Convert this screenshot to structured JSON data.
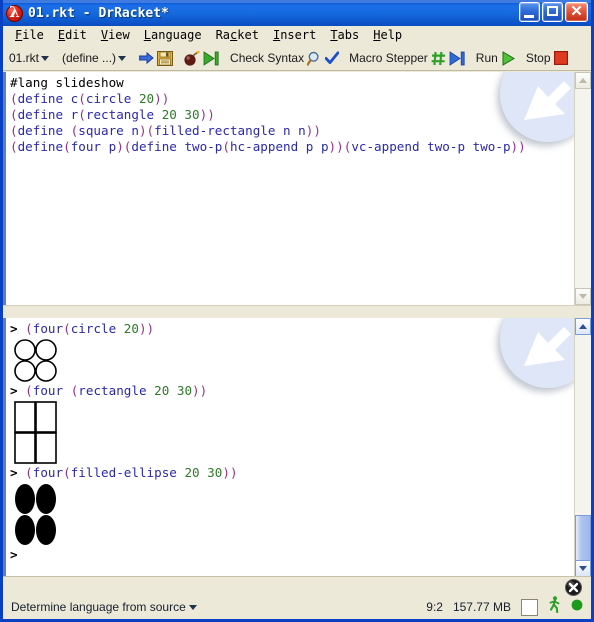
{
  "window": {
    "title": "01.rkt - DrRacket*",
    "app_icon": "racket-lambda-icon",
    "caption": {
      "minimize_label": "Minimize",
      "maximize_label": "Maximize",
      "close_label": "Close",
      "close_glyph": "✕"
    },
    "titlebar_color": "#1465DD",
    "frame_color": "#0A41C4",
    "chrome_color": "#ECE9D8"
  },
  "menubar": {
    "items": [
      {
        "pre": "",
        "mn": "F",
        "post": "ile"
      },
      {
        "pre": "",
        "mn": "E",
        "post": "dit"
      },
      {
        "pre": "",
        "mn": "V",
        "post": "iew"
      },
      {
        "pre": "",
        "mn": "L",
        "post": "anguage"
      },
      {
        "pre": "Ra",
        "mn": "c",
        "post": "ket"
      },
      {
        "pre": "",
        "mn": "I",
        "post": "nsert"
      },
      {
        "pre": "",
        "mn": "T",
        "post": "abs"
      },
      {
        "pre": "",
        "mn": "H",
        "post": "elp"
      }
    ]
  },
  "toolbar": {
    "file_dropdown": "01.rkt",
    "definition_dropdown": "(define ...)",
    "save_icon": "floppy-disk-icon",
    "arrow_icon": "arrow-right-icon",
    "bomb_icon": "bomb-icon",
    "step_icon": "step-forward-icon",
    "check_syntax_label": "Check Syntax",
    "magnifier_icon": "magnifier-icon",
    "check_icon": "checkmark-icon",
    "macro_stepper_label": "Macro Stepper",
    "hash_icon": "macro-hash-icon",
    "macro_step_icon": "step-forward-icon",
    "run_label": "Run",
    "run_icon": "play-triangle-icon",
    "stop_label": "Stop",
    "stop_icon": "stop-square-icon"
  },
  "editor": {
    "watermark_icon": "arrow-down-left-watermark",
    "lines": [
      [
        {
          "t": "#lang slideshow",
          "c": "plain"
        }
      ],
      [
        {
          "t": "(",
          "c": "paren"
        },
        {
          "t": "define c",
          "c": "kw"
        },
        {
          "t": "(",
          "c": "paren"
        },
        {
          "t": "circle ",
          "c": "kw"
        },
        {
          "t": "20",
          "c": "num"
        },
        {
          "t": "))",
          "c": "paren"
        }
      ],
      [
        {
          "t": "(",
          "c": "paren"
        },
        {
          "t": "define r",
          "c": "kw"
        },
        {
          "t": "(",
          "c": "paren"
        },
        {
          "t": "rectangle ",
          "c": "kw"
        },
        {
          "t": "20 30",
          "c": "num"
        },
        {
          "t": "))",
          "c": "paren"
        }
      ],
      [
        {
          "t": "(",
          "c": "paren"
        },
        {
          "t": "define ",
          "c": "kw"
        },
        {
          "t": "(",
          "c": "paren"
        },
        {
          "t": "square n",
          "c": "kw"
        },
        {
          "t": ")",
          "c": "paren"
        },
        {
          "t": "(",
          "c": "paren"
        },
        {
          "t": "filled-rectangle n n",
          "c": "kw"
        },
        {
          "t": "))",
          "c": "paren"
        }
      ],
      [
        {
          "t": "(",
          "c": "paren"
        },
        {
          "t": "define",
          "c": "kw"
        },
        {
          "t": "(",
          "c": "paren"
        },
        {
          "t": "four p",
          "c": "kw"
        },
        {
          "t": ")",
          "c": "paren"
        },
        {
          "t": "(",
          "c": "paren"
        },
        {
          "t": "define two-p",
          "c": "kw"
        },
        {
          "t": "(",
          "c": "paren"
        },
        {
          "t": "hc-append p p",
          "c": "kw"
        },
        {
          "t": "))",
          "c": "paren"
        },
        {
          "t": "(",
          "c": "paren"
        },
        {
          "t": "vc-append two-p two-p",
          "c": "kw"
        },
        {
          "t": "))",
          "c": "paren"
        }
      ]
    ],
    "scrollbar": {
      "thumb_visible": false
    }
  },
  "repl": {
    "watermark_icon": "arrow-down-left-watermark",
    "entries": [
      {
        "prompt": "> ",
        "expr": [
          {
            "t": "(",
            "c": "paren"
          },
          {
            "t": "four",
            "c": "kw"
          },
          {
            "t": "(",
            "c": "paren"
          },
          {
            "t": "circle ",
            "c": "kw"
          },
          {
            "t": "20",
            "c": "num"
          },
          {
            "t": "))",
            "c": "paren"
          }
        ],
        "picture": "four-circles"
      },
      {
        "prompt": "> ",
        "expr": [
          {
            "t": "(",
            "c": "paren"
          },
          {
            "t": "four ",
            "c": "kw"
          },
          {
            "t": "(",
            "c": "paren"
          },
          {
            "t": "rectangle ",
            "c": "kw"
          },
          {
            "t": "20 30",
            "c": "num"
          },
          {
            "t": "))",
            "c": "paren"
          }
        ],
        "picture": "four-rectangles"
      },
      {
        "prompt": "> ",
        "expr": [
          {
            "t": "(",
            "c": "paren"
          },
          {
            "t": "four",
            "c": "kw"
          },
          {
            "t": "(",
            "c": "paren"
          },
          {
            "t": "filled-ellipse ",
            "c": "kw"
          },
          {
            "t": "20 30",
            "c": "num"
          },
          {
            "t": "))",
            "c": "paren"
          }
        ],
        "picture": "four-filled-ellipses"
      },
      {
        "prompt": "> ",
        "expr": [],
        "picture": null
      }
    ],
    "scrollbar": {
      "thumb_visible": true
    }
  },
  "statusbar": {
    "language_label": "Determine language from source",
    "cursor_position": "9:2",
    "memory_usage": "157.77 MB",
    "memory_box": "memory-indicator",
    "running_man_icon": "running-man-icon",
    "status_dot_icon": "status-dot-icon",
    "status_dot_color": "#1C9A1C",
    "close_badge_icon": "close-circle-icon"
  }
}
